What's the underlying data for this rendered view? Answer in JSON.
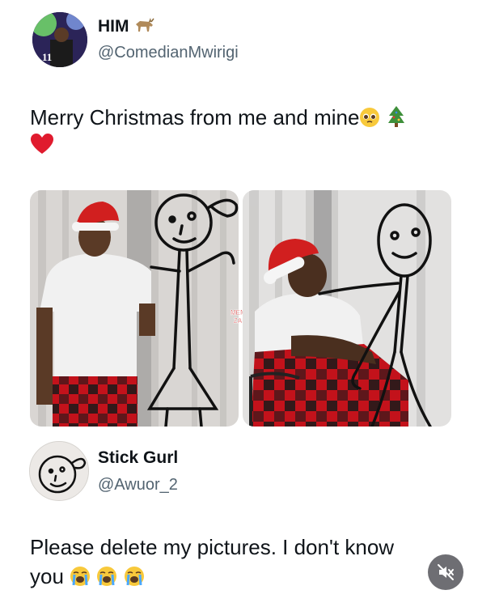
{
  "post1": {
    "display_name": "HIM",
    "name_emoji": "goat-emoji",
    "handle": "@ComedianMwirigi",
    "text_line1": "Merry Christmas from me and mine",
    "text_emojis": [
      "pleading-face-emoji",
      "christmas-tree-emoji"
    ],
    "text_line2_emoji": "red-heart-emoji",
    "watermark": "MEME ZAR"
  },
  "post2": {
    "display_name": "Stick Gurl",
    "handle": "@Awuor_2",
    "text_line1": "Please delete my pictures. I don't know",
    "text_line2": "you",
    "text_emojis": [
      "loudly-crying-face-emoji",
      "loudly-crying-face-emoji",
      "loudly-crying-face-emoji"
    ],
    "mute_icon": "mute-icon"
  },
  "colors": {
    "text": "#0f1419",
    "secondary": "#536471",
    "santa_red": "#d11f1f",
    "plaid_red": "#c3121b",
    "mute_bg": "#6e6e73"
  }
}
